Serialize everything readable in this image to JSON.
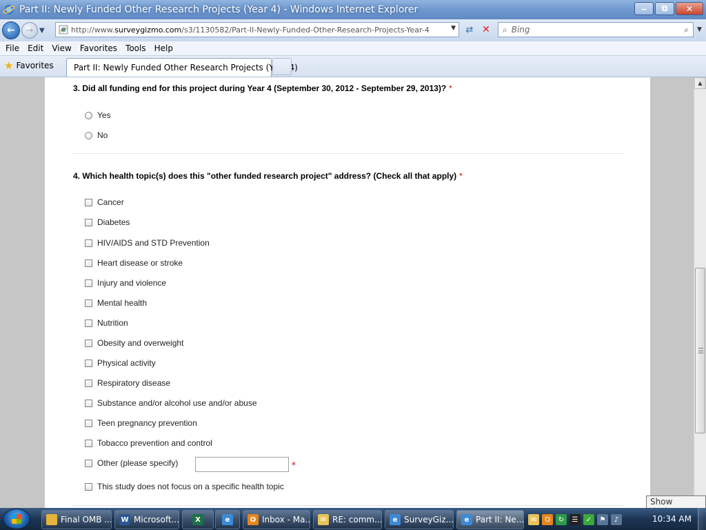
{
  "window": {
    "title": "Part II: Newly Funded Other Research Projects (Year 4) - Windows Internet Explorer",
    "minimize_label": "‒",
    "maximize_label": "⧉",
    "close_label": "✕"
  },
  "navbar": {
    "url_prefix": "http://www.",
    "url_domain": "surveygizmo.com",
    "url_path": "/s3/1130582/Part-II-Newly-Funded-Other-Research-Projects-Year-4",
    "search_placeholder": "Bing"
  },
  "menu": {
    "items": [
      "File",
      "Edit",
      "View",
      "Favorites",
      "Tools",
      "Help"
    ]
  },
  "favorites_bar": {
    "favorites_label": "Favorites",
    "tab_title": "Part II: Newly Funded Other Research Projects (Year 4)"
  },
  "survey": {
    "q3": {
      "text": "3. Did all funding end for this project during Year 4 (September 30, 2012 - September 29, 2013)?",
      "required_mark": "*",
      "options": [
        "Yes",
        "No"
      ]
    },
    "q4": {
      "text": "4. Which health topic(s) does this \"other funded research project\" address? (Check all that apply)",
      "required_mark": "*",
      "options": [
        "Cancer",
        "Diabetes",
        "HIV/AIDS and STD Prevention",
        "Heart disease or stroke",
        "Injury and violence",
        "Mental health",
        "Nutrition",
        "Obesity and overweight",
        "Physical activity",
        "Respiratory disease",
        "Substance and/or alcohol use and/or abuse",
        "Teen pregnancy prevention",
        "Tobacco prevention and control",
        "Other (please specify)",
        "This study does not focus on a specific health topic"
      ],
      "other_required_mark": "*"
    }
  },
  "tooltip": {
    "text": "Show desktop"
  },
  "taskbar": {
    "items": [
      {
        "label": "Final OMB ...",
        "icon": "folder-icon",
        "color": "#e8b33a"
      },
      {
        "label": "Microsoft...",
        "icon": "word-icon",
        "color": "#2b5797"
      },
      {
        "label": "",
        "icon": "excel-icon",
        "color": "#1e7145"
      },
      {
        "label": "",
        "icon": "ie-icon",
        "color": "#3c8ad7"
      },
      {
        "label": "Inbox - Ma...",
        "icon": "outlook-icon",
        "color": "#e3861d"
      },
      {
        "label": "RE: comm...",
        "icon": "mail-icon",
        "color": "#e7c35a"
      },
      {
        "label": "SurveyGiz...",
        "icon": "ie-icon",
        "color": "#3c8ad7"
      },
      {
        "label": "Part II: Ne...",
        "icon": "ie-icon",
        "color": "#3c8ad7"
      }
    ],
    "clock": "10:34 AM"
  }
}
